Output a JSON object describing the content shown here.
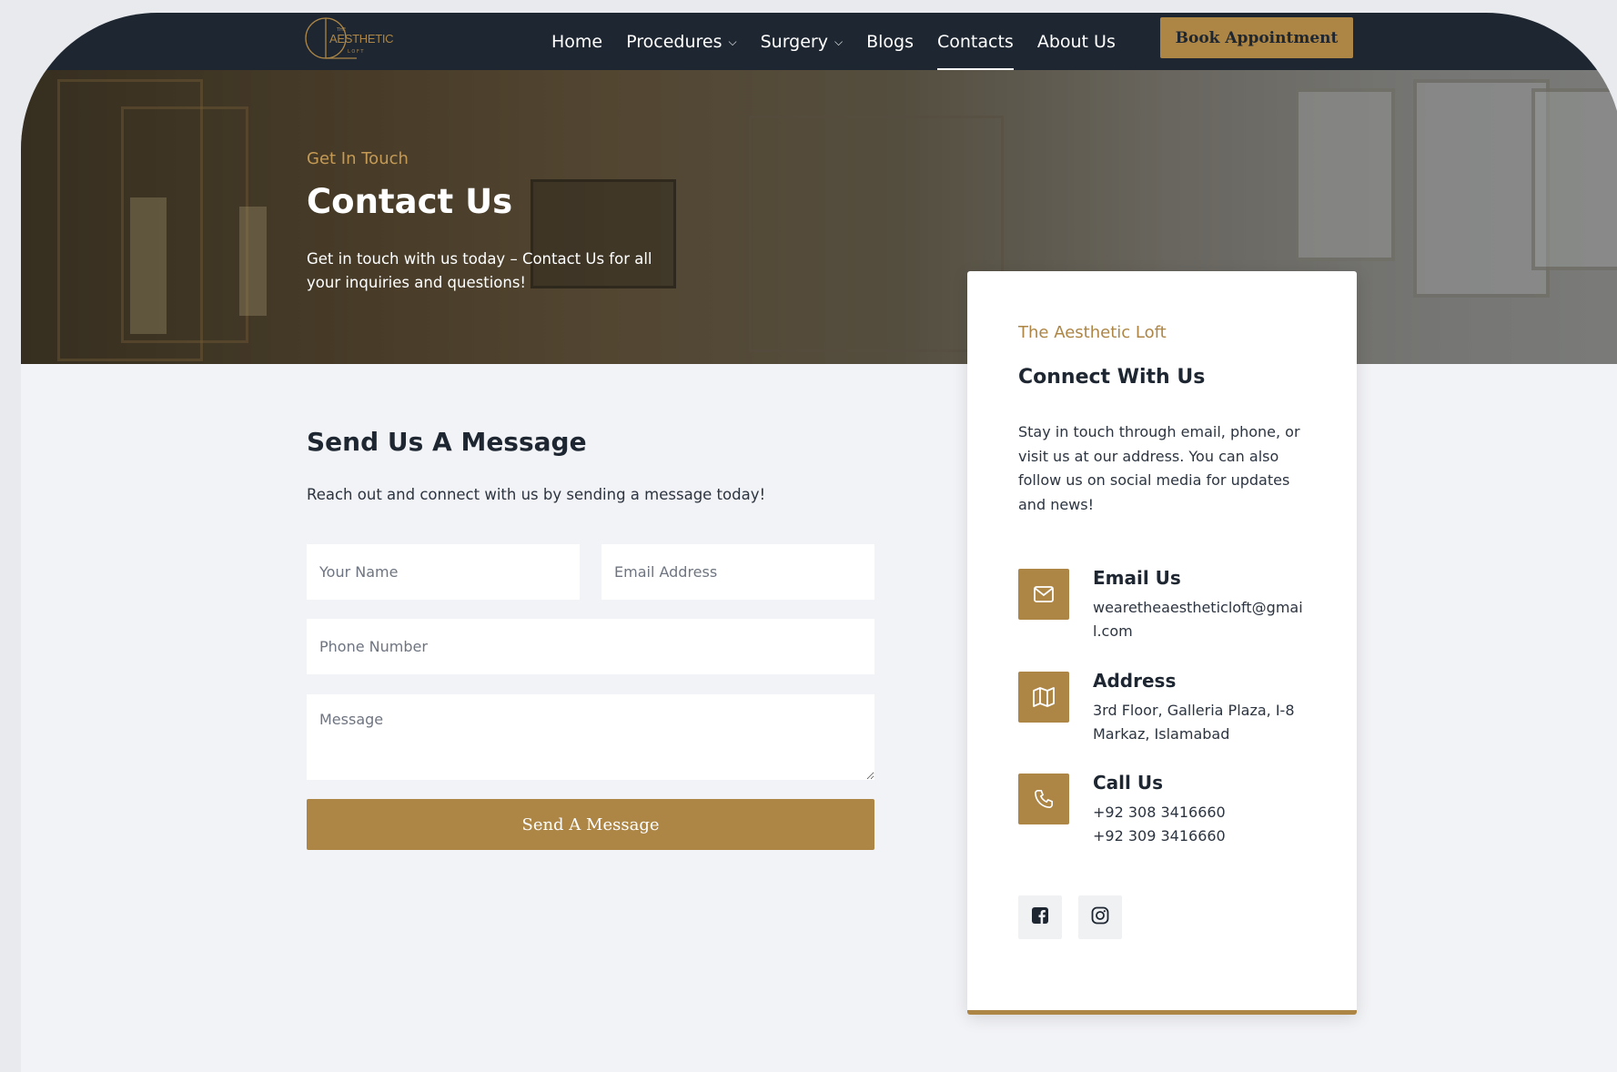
{
  "nav": {
    "logo_text": "AESTHETIC",
    "items": [
      {
        "label": "Home"
      },
      {
        "label": "Procedures"
      },
      {
        "label": "Surgery"
      },
      {
        "label": "Blogs"
      },
      {
        "label": "Contacts"
      },
      {
        "label": "About Us"
      }
    ],
    "active": "Contacts",
    "cta_label": "Book Appointment"
  },
  "hero": {
    "eyebrow": "Get In Touch",
    "title": "Contact Us",
    "subtitle": "Get in touch with us today – Contact Us for all your inquiries and questions!"
  },
  "form": {
    "title": "Send Us A Message",
    "subtitle": "Reach out and connect with us by sending a message today!",
    "name_placeholder": "Your Name",
    "email_placeholder": "Email Address",
    "phone_placeholder": "Phone Number",
    "message_placeholder": "Message",
    "submit_label": "Send A Message"
  },
  "card": {
    "eyebrow": "The Aesthetic Loft",
    "title": "Connect With Us",
    "description": "Stay in touch through email, phone, or visit us at our address. You can also follow us on social media for updates and news!",
    "email": {
      "title": "Email Us",
      "value": "wearetheaestheticloft@gmail.com",
      "icon": "mail-icon"
    },
    "address": {
      "title": "Address",
      "value": "3rd Floor, Galleria Plaza, I-8 Markaz, Islamabad",
      "icon": "map-icon"
    },
    "phone": {
      "title": "Call Us",
      "line1": "+92 308 3416660",
      "line2": "+92 309 3416660",
      "icon": "phone-icon"
    },
    "socials": [
      "facebook-icon",
      "instagram-icon"
    ]
  },
  "colors": {
    "navy": "#1d2631",
    "gold": "#ad8646",
    "background": "#f2f3f6"
  }
}
